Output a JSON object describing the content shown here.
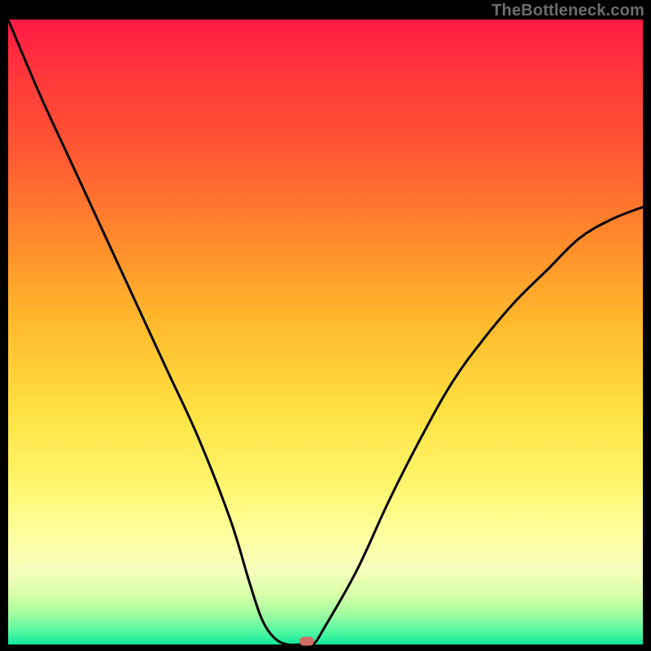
{
  "watermark": "TheBottleneck.com",
  "colors": {
    "curve": "#000000",
    "marker": "#cf6e66"
  },
  "chart_data": {
    "type": "line",
    "title": "",
    "xlabel": "",
    "ylabel": "",
    "xlim": [
      0,
      100
    ],
    "ylim": [
      0,
      100
    ],
    "grid": false,
    "series": [
      {
        "name": "bottleneck-curve",
        "x": [
          0,
          5,
          10,
          15,
          20,
          25,
          30,
          35,
          38,
          40,
          42,
          44,
          46,
          48,
          50,
          55,
          60,
          65,
          70,
          75,
          80,
          85,
          90,
          95,
          100
        ],
        "y": [
          100,
          88,
          77,
          66,
          55,
          44,
          33,
          20,
          10,
          4,
          1,
          0,
          0,
          0,
          3,
          12,
          23,
          33,
          42,
          49,
          55,
          60,
          65,
          68,
          70
        ]
      }
    ],
    "annotations": [
      {
        "name": "optimal-point",
        "x": 47,
        "y": 0
      }
    ]
  }
}
